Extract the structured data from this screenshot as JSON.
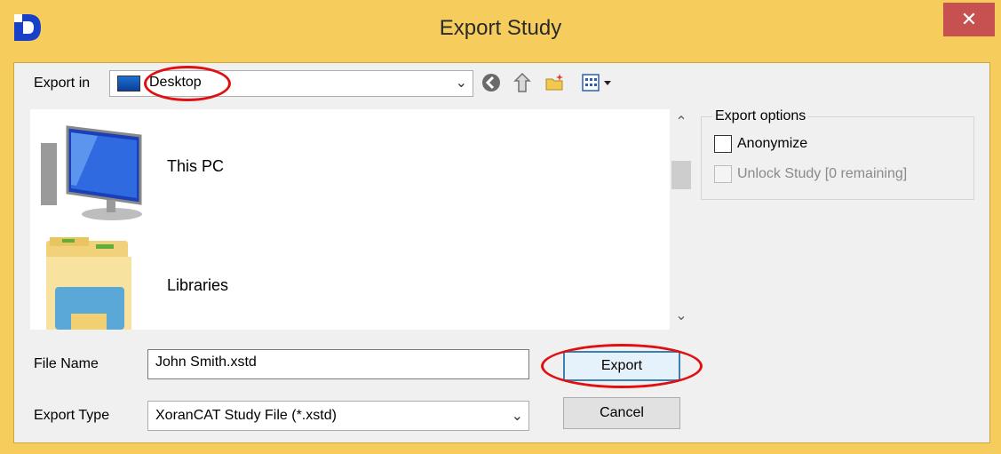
{
  "window": {
    "title": "Export Study",
    "close_glyph": "✕"
  },
  "export_in": {
    "label": "Export in",
    "value": "Desktop"
  },
  "file_list": {
    "items": [
      {
        "label": "This PC",
        "icon": "computer-icon"
      },
      {
        "label": "Libraries",
        "icon": "libraries-folder-icon"
      }
    ]
  },
  "export_options": {
    "group_title": "Export options",
    "anonymize": {
      "label": "Anonymize",
      "checked": false
    },
    "unlock": {
      "label": "Unlock Study [0 remaining]",
      "checked": false,
      "disabled": true
    }
  },
  "file_name": {
    "label": "File Name",
    "value": "John Smith.xstd"
  },
  "export_type": {
    "label": "Export Type",
    "value": "XoranCAT Study File (*.xstd)"
  },
  "buttons": {
    "export": "Export",
    "cancel": "Cancel"
  },
  "colors": {
    "title_bar": "#f6cd5d",
    "close_button": "#c75050",
    "highlight_circle": "#e01010",
    "default_button_border": "#3c7fb1"
  }
}
